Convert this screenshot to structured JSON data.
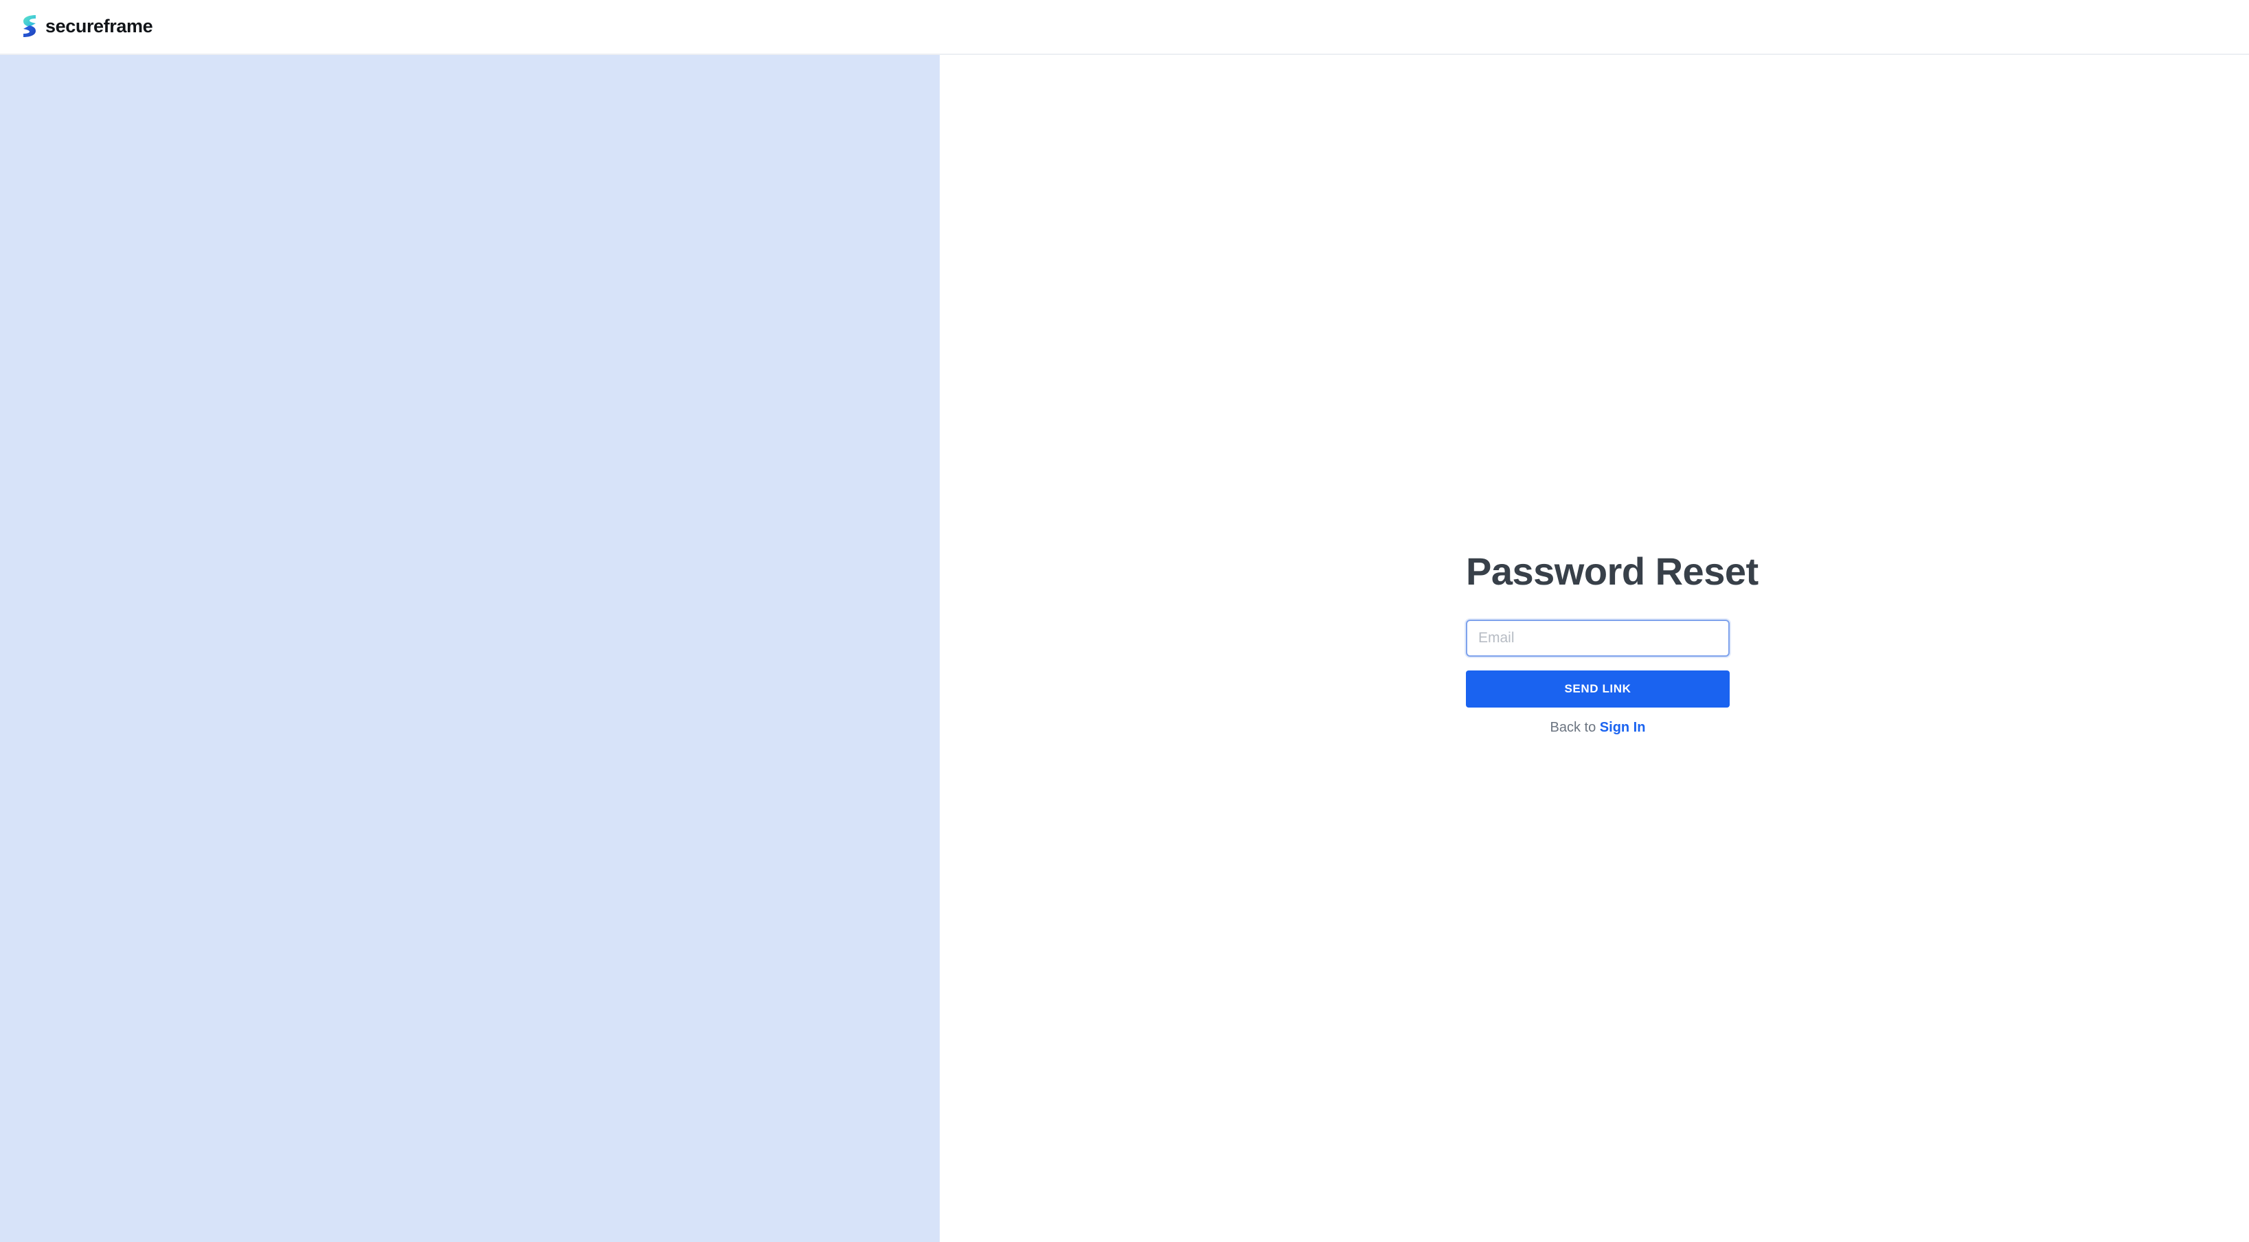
{
  "brand": {
    "name": "secureframe",
    "logo_icon": "secureframe-logo-icon"
  },
  "colors": {
    "accent": "#1a63f0",
    "left_panel": "#d7e3f9",
    "title": "#384049"
  },
  "form": {
    "title": "Password Reset",
    "email_placeholder": "Email",
    "email_value": "",
    "send_label": "SEND LINK",
    "back_prefix": "Back to",
    "sign_in_label": "Sign In"
  }
}
